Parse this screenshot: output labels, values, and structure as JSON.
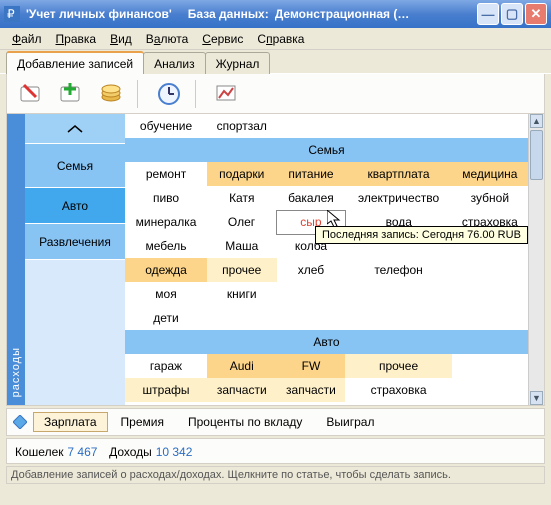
{
  "title": {
    "app": "'Учет личных финансов'",
    "db_label": "База данных:",
    "db_value": "Демонстрационная (…"
  },
  "menu": {
    "file": "Файл",
    "edit": "Правка",
    "view": "Вид",
    "currency": "Валюта",
    "service": "Сервис",
    "help": "Справка"
  },
  "tabs": {
    "add": "Добавление записей",
    "analysis": "Анализ",
    "journal": "Журнал"
  },
  "leftlabel": "расходы",
  "side": {
    "up": "⌃",
    "family": "Семья",
    "auto": "Авто",
    "fun": "Развлечения"
  },
  "row0": {
    "c0": "обучение",
    "c1": "спортзал"
  },
  "family_hdr": "Семья",
  "family": {
    "r1": {
      "c0": "ремонт",
      "c1": "подарки",
      "c2": "питание",
      "c3": "квартплата",
      "c4": "медицина"
    },
    "r2": {
      "c0": "пиво",
      "c1": "Катя",
      "c2": "бакалея",
      "c3": "электричество",
      "c4": "зубной"
    },
    "r3": {
      "c0": "минералка",
      "c1": "Олег",
      "c2": "сыр",
      "c3": "вода",
      "c4": "страховка"
    },
    "r4": {
      "c0": "мебель",
      "c1": "Маша",
      "c2": "колба"
    },
    "r5": {
      "c0": "одежда",
      "c1": "прочее",
      "c2": "хлеб",
      "c3": "телефон"
    },
    "r6": {
      "c0": "моя",
      "c1": "книги"
    },
    "r7": {
      "c0": "дети"
    }
  },
  "auto_hdr": "Авто",
  "auto": {
    "r1": {
      "c0": "гараж",
      "c1": "Audi",
      "c2": "FW",
      "c3": "прочее"
    },
    "r2": {
      "c0": "штрафы",
      "c1": "запчасти",
      "c2": "запчасти",
      "c3": "страховка"
    }
  },
  "tooltip": "Последняя запись: Сегодня  76.00  RUB",
  "income": {
    "salary": "Зарплата",
    "bonus": "Премия",
    "interest": "Проценты по вкладу",
    "won": "Выиграл"
  },
  "summary": {
    "wallet_l": "Кошелек",
    "wallet_v": "7 467",
    "income_l": "Доходы",
    "income_v": "10 342"
  },
  "status": "Добавление записей о расходах/доходах. Щелкните по статье, чтобы сделать запись."
}
